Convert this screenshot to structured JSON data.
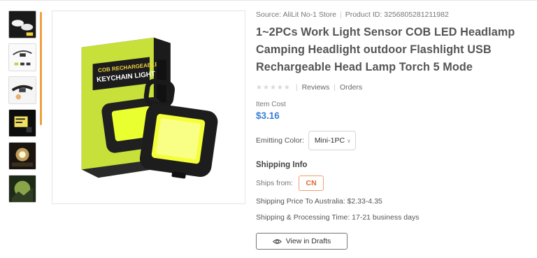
{
  "product": {
    "source_label": "Source: AliLit No-1 Store",
    "product_id_label": "Product ID: 3256805281211982",
    "title": "1~2PCs Work Light Sensor COB LED Headlamp Camping Headlight outdoor Flashlight USB Rechargeable Head Lamp Torch 5 Mode",
    "rating": 0,
    "reviews_label": "Reviews",
    "orders_label": "Orders",
    "item_cost_label": "Item Cost",
    "item_cost": "$3.16",
    "emitting_color_label": "Emitting Color:",
    "emitting_color_value": "Mini-1PC",
    "box_text_top": "COB RECHARGEABLE",
    "box_text_bottom": "KEYCHAIN LIGHT"
  },
  "shipping": {
    "title": "Shipping Info",
    "ships_from_label": "Ships from:",
    "ships_from_value": "CN",
    "price_label": "Shipping Price To Australia: $2.33-4.35",
    "time_label": "Shipping & Processing Time: 17-21 business days"
  },
  "actions": {
    "view_drafts": "View in Drafts"
  },
  "thumbnails": [
    "headlamp-thumb-1",
    "headlamp-thumb-2",
    "headlamp-thumb-3",
    "headlamp-thumb-4",
    "headlamp-thumb-5",
    "headlamp-thumb-6"
  ],
  "colors": {
    "price": "#3a7fd5",
    "cn_accent": "#e06a2c",
    "scroll_accent": "#f0a040",
    "box_green": "#c8e03a"
  }
}
